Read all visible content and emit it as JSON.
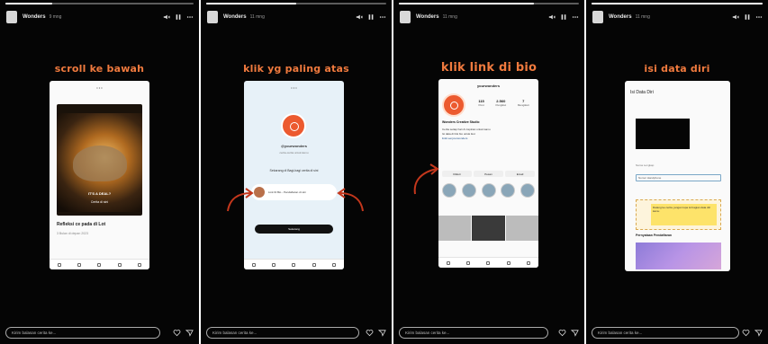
{
  "stories": [
    {
      "username": "Wonders",
      "time": "9 mng",
      "caption": "scroll ke bawah",
      "reply_placeholder": "Kirim balasan cerita ke...",
      "progress": 0.25,
      "post": {
        "label1": "IT'S A DEAL?",
        "label2": "Cerita di sini",
        "title": "Refleksi ce pada di Lot",
        "meta": "3 Bulan di depan 2023"
      }
    },
    {
      "username": "Wonders",
      "time": "11 mng",
      "caption": "klik yg paling atas",
      "reply_placeholder": "Kirim balasan cerita ke...",
      "progress": 0.5,
      "profile": {
        "handle": "@yourwonders",
        "subtitle": "cerita-cerita untuk kamu",
        "description": "Sekarang di Bagi-bagi cerita di sini",
        "link_text": "Link Di Bio - Pendaftaran di sini",
        "cookie": "Sekarang"
      }
    },
    {
      "username": "Wonders",
      "time": "11 mng",
      "caption": "klik link di bio",
      "reply_placeholder": "Kirim balasan cerita ke...",
      "progress": 0.75,
      "ig": {
        "username": "yourwonders",
        "posts": "115",
        "followers": "2.560",
        "following": "7",
        "posts_label": "Post",
        "followers_label": "Pengikut",
        "following_label": "Mengikuti",
        "name": "Wonders Creative Studio",
        "bio_line1": "Cerita setiap hari & inspirasi untuk kamu",
        "bio_line2": "Isi data di link bio untuk ikut",
        "bio_link": "linktr.ee/yourwonders",
        "btn1": "Diikuti",
        "btn2": "Pesan",
        "btn3": "Email"
      }
    },
    {
      "username": "Wonders",
      "time": "11 mng",
      "caption": "isi data diri",
      "reply_placeholder": "Kirim balasan cerita ke...",
      "progress": 1.0,
      "form": {
        "title": "Isi Data Diri",
        "label1": "Nama Lengkap",
        "field_value": "Nomor Handphone",
        "notice": "Datang ke cerita, jangan lupa isi bagian data diri kamu",
        "notice_head": "Pernyataan Pendaftaran"
      }
    }
  ]
}
